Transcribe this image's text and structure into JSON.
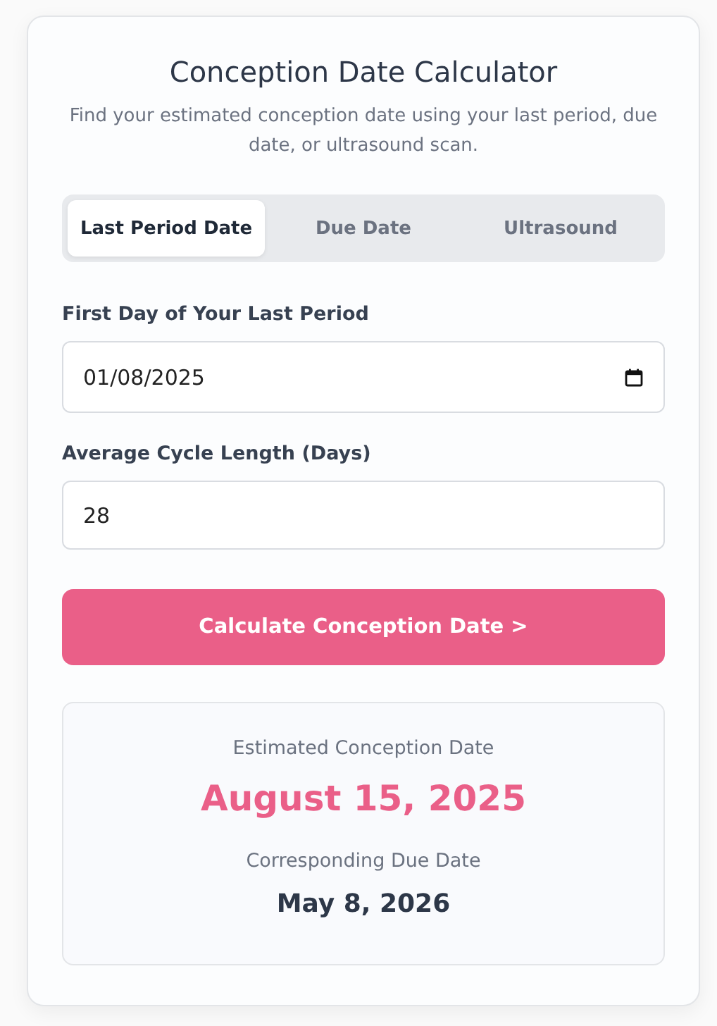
{
  "title": "Conception Date Calculator",
  "subtitle": "Find your estimated conception date using your last period, due date, or ultrasound scan.",
  "tabs": [
    {
      "label": "Last Period Date",
      "selected": true
    },
    {
      "label": "Due Date",
      "selected": false
    },
    {
      "label": "Ultrasound",
      "selected": false
    }
  ],
  "fields": [
    {
      "kind": "date",
      "label": "First Day of Your Last Period",
      "value": "01/08/2025"
    },
    {
      "kind": "number",
      "label": "Average Cycle Length (Days)",
      "value": "28"
    }
  ],
  "button": "Calculate Conception Date >",
  "result": {
    "conception_label": "Estimated Conception Date",
    "conception_date": "August 15, 2025",
    "due_label": "Corresponding Due Date",
    "due_date": "May 8, 2026"
  }
}
